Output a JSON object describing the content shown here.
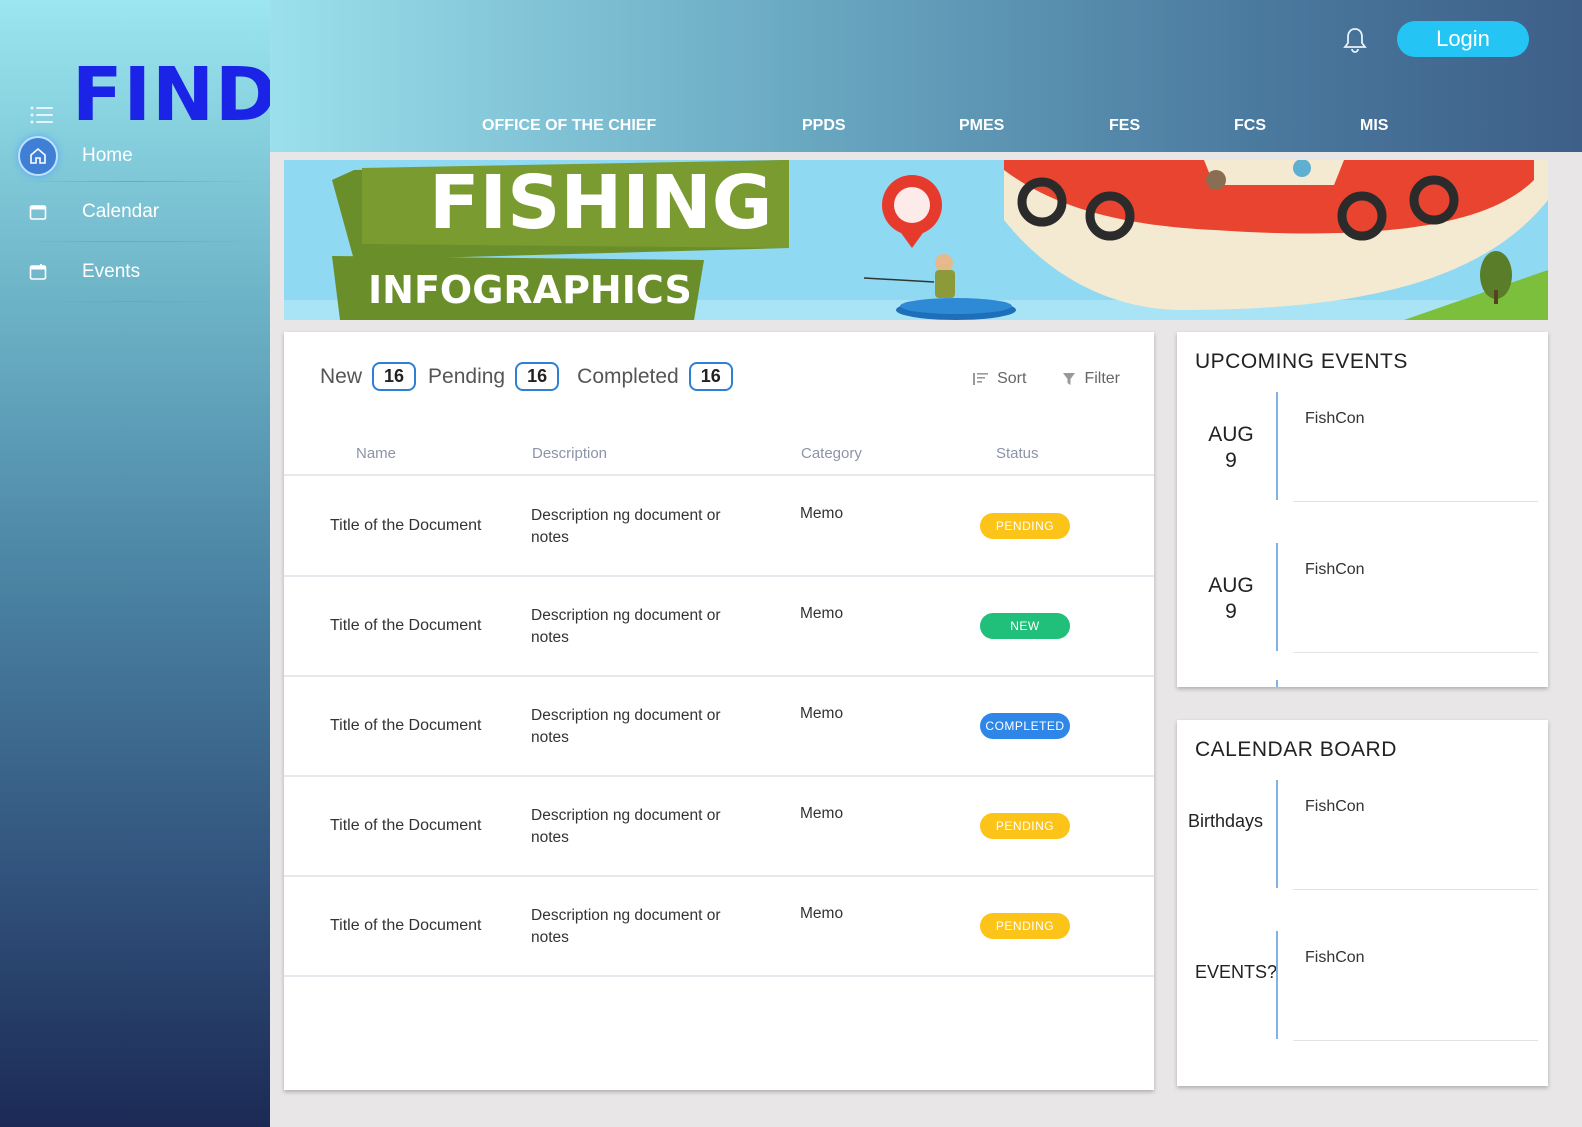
{
  "app": {
    "logo": "FIND"
  },
  "sidebar": {
    "items": [
      {
        "label": "Home",
        "icon": "home-icon",
        "active": true
      },
      {
        "label": "Calendar",
        "icon": "calendar-icon",
        "active": false
      },
      {
        "label": "Events",
        "icon": "calendar-icon",
        "active": false
      }
    ]
  },
  "header": {
    "login_label": "Login",
    "nav": [
      "OFFICE OF THE CHIEF",
      "PPDS",
      "PMES",
      "FES",
      "FCS",
      "MIS"
    ]
  },
  "banner": {
    "title": "FISHING",
    "subtitle": "INFOGRAPHICS"
  },
  "docs": {
    "counts": [
      {
        "label": "New",
        "count": "16"
      },
      {
        "label": "Pending",
        "count": "16"
      },
      {
        "label": "Completed",
        "count": "16"
      }
    ],
    "sort_label": "Sort",
    "filter_label": "Filter",
    "columns": [
      "Name",
      "Description",
      "Category",
      "Status"
    ],
    "rows": [
      {
        "name": "Title of the Document",
        "desc": "Description ng document or notes",
        "category": "Memo",
        "status": "PENDING"
      },
      {
        "name": "Title of the Document",
        "desc": "Description ng document or notes",
        "category": "Memo",
        "status": "NEW"
      },
      {
        "name": "Title of the Document",
        "desc": "Description ng document or notes",
        "category": "Memo",
        "status": "COMPLETED"
      },
      {
        "name": "Title of the Document",
        "desc": "Description ng document or notes",
        "category": "Memo",
        "status": "PENDING"
      },
      {
        "name": "Title of the Document",
        "desc": "Description ng document or notes",
        "category": "Memo",
        "status": "PENDING"
      }
    ]
  },
  "status_colors": {
    "PENDING": "#fcc419",
    "NEW": "#20c07a",
    "COMPLETED": "#2d86e8"
  },
  "upcoming": {
    "title": "UPCOMING EVENTS",
    "events": [
      {
        "month": "AUG",
        "day": "9",
        "title": "FishCon"
      },
      {
        "month": "AUG",
        "day": "9",
        "title": "FishCon"
      }
    ]
  },
  "calendar_board": {
    "title": "CALENDAR BOARD",
    "entries": [
      {
        "label": "Birthdays",
        "title": "FishCon"
      },
      {
        "label": "EVENTS?",
        "title": "FishCon"
      }
    ]
  }
}
